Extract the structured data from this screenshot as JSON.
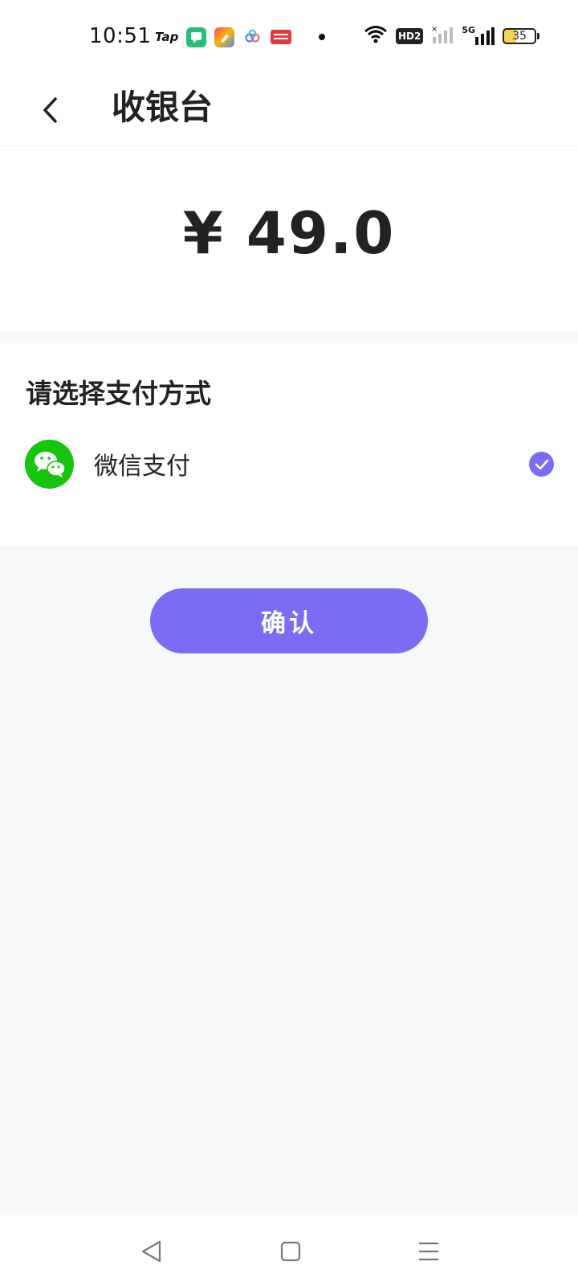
{
  "status_bar": {
    "time": "10:51",
    "tap_label": "Tap",
    "hd_label": "HD2",
    "network_label": "5G",
    "battery": "35",
    "icons": [
      "tap-icon",
      "chat-app-icon",
      "paint-app-icon",
      "cloud-app-icon",
      "toutiao-icon",
      "wifi-icon",
      "hd-icon",
      "signal-1-icon",
      "signal-5g-icon",
      "battery-icon"
    ],
    "colors": {
      "chat_app": "#22c17a",
      "toutiao": "#e4393c"
    }
  },
  "header": {
    "back_icon": "chevron-left-icon",
    "title": "收银台"
  },
  "amount": {
    "value": "¥ 49.0"
  },
  "payment": {
    "heading": "请选择支付方式",
    "options": [
      {
        "label": "微信支付",
        "icon": "wechat-icon",
        "selected": true
      }
    ]
  },
  "confirm": {
    "label": "确认"
  },
  "nav_bar": {
    "icons": [
      "nav-back-icon",
      "nav-home-icon",
      "nav-menu-icon"
    ]
  },
  "colors": {
    "accent": "#7b6cf6",
    "wechat_green": "#16c60c",
    "background": "#f7f8fa"
  }
}
